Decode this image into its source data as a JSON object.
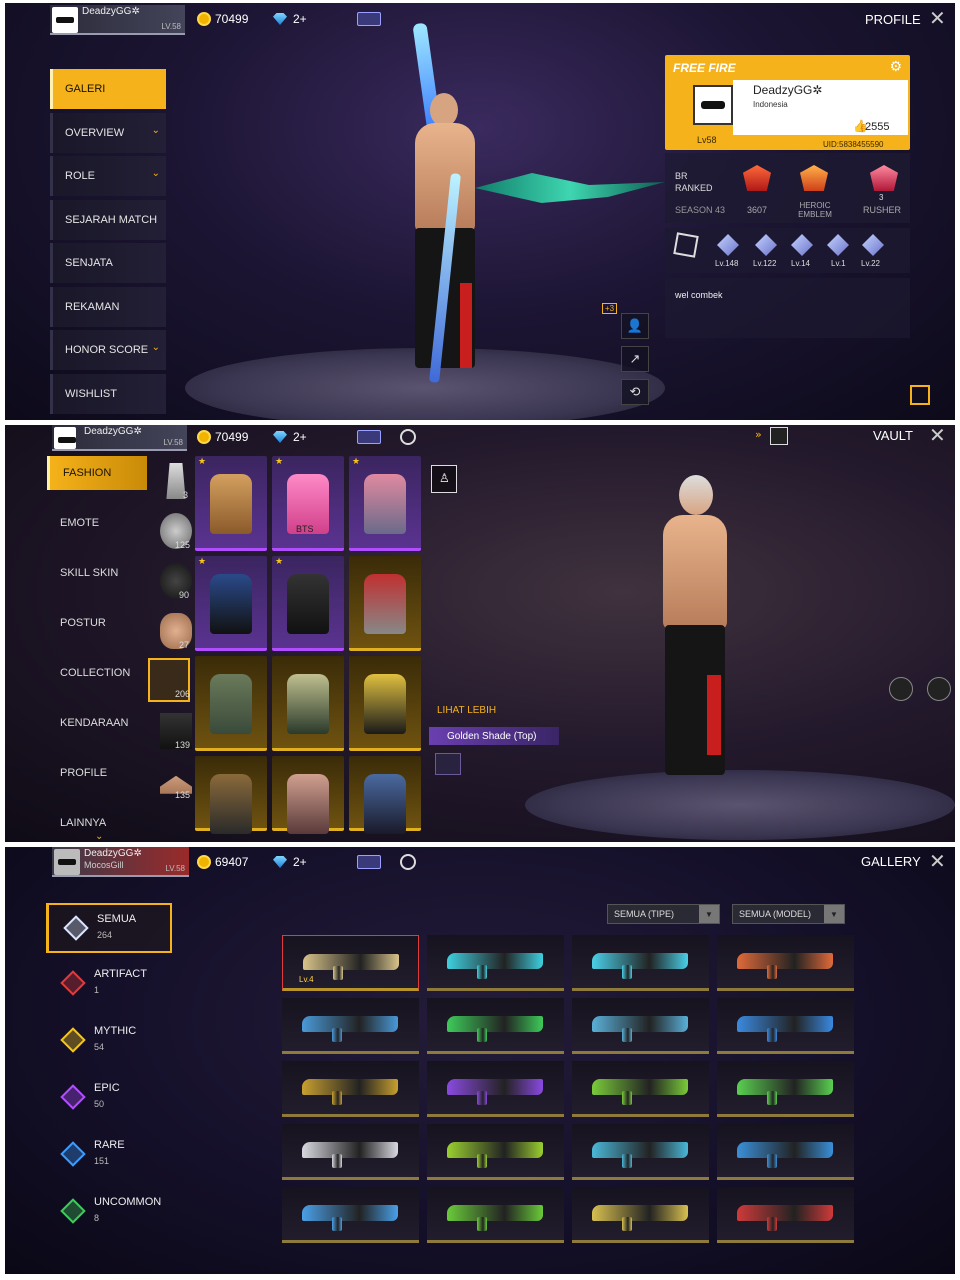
{
  "colors": {
    "accent": "#f5b21a",
    "purple": "#b14cff",
    "gold": "#e0b020"
  },
  "player": {
    "name": "DeadzyGG✲",
    "level": "LV.58",
    "gold": "70499",
    "diamonds": "2+"
  },
  "profile_screen": {
    "title": "PROFILE",
    "menu": [
      "GALERI",
      "OVERVIEW",
      "ROLE",
      "SEJARAH MATCH",
      "SENJATA",
      "REKAMAN",
      "HONOR SCORE",
      "WISHLIST"
    ],
    "card": {
      "brand": "FREE FIRE",
      "name": "DeadzyGG✲",
      "country": "Indonesia",
      "level": "Lv58",
      "likes": "2555",
      "uid": "UID:5838455590"
    },
    "ranked": {
      "label_line1": "BR",
      "label_line2": "RANKED",
      "season": "SEASON 43",
      "points": "3607",
      "rank_name": "HEROIC EMBLEM",
      "badge3_label": "RUSHER",
      "badge3_count": "3"
    },
    "skin_levels": [
      "Lv.148",
      "Lv.122",
      "Lv.14",
      "Lv.1",
      "Lv.22"
    ],
    "signature": "wel combek",
    "plus_badge": "+3"
  },
  "vault_screen": {
    "title": "VAULT",
    "menu": [
      "FASHION",
      "EMOTE",
      "SKILL SKIN",
      "POSTUR",
      "COLLECTION",
      "KENDARAAN",
      "PROFILE",
      "LAINNYA"
    ],
    "category_counts": [
      "3",
      "125",
      "90",
      "27",
      "206",
      "139",
      "135"
    ],
    "tile_text": "BTS",
    "see_more": "LIHAT LEBIH",
    "item_name": "Golden Shade (Top)"
  },
  "gallery_screen": {
    "title": "GALLERY",
    "player_name_line2": "MocosGill",
    "gold": "69407",
    "filters": [
      {
        "label": "SEMUA",
        "count": "264",
        "color": "#d9e4ff"
      },
      {
        "label": "ARTIFACT",
        "count": "1",
        "color": "#e03a3a"
      },
      {
        "label": "MYTHIC",
        "count": "54",
        "color": "#f5c518"
      },
      {
        "label": "EPIC",
        "count": "50",
        "color": "#b14cff"
      },
      {
        "label": "RARE",
        "count": "151",
        "color": "#3a9cff"
      },
      {
        "label": "UNCOMMON",
        "count": "8",
        "color": "#3ecb5a"
      }
    ],
    "dropdown_type": "SEMUA (TIPE)",
    "dropdown_model": "SEMUA (MODEL)",
    "first_item_level": "Lv.4"
  }
}
